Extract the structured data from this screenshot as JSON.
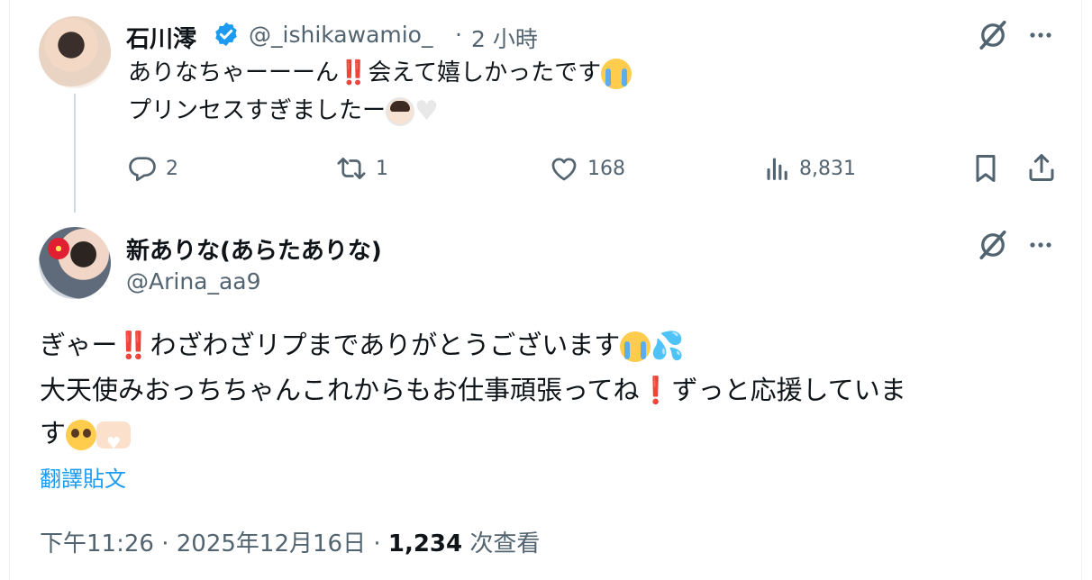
{
  "reply_tweet": {
    "author_name": "石川澪",
    "handle": "@_ishikawamio_",
    "separator": "·",
    "time": "2 小時",
    "line1_prefix": "ありなちゃーーーん",
    "line1_bang": "‼️",
    "line1_mid": "会えて嬉しかったです",
    "line2": "プリンセスすぎましたー",
    "stats": {
      "replies": "2",
      "reposts": "1",
      "likes": "168",
      "views": "8,831"
    }
  },
  "main_tweet": {
    "author_name": "新ありな(あらたありな)",
    "handle": "@Arina_aa9",
    "line1_prefix": "ぎゃー",
    "line1_bang": "‼️",
    "line1_rest": "わざわざリプまでありがとうございます",
    "line2_prefix": "大天使みおっちちゃんこれからもお仕事頑張ってね",
    "line2_bang": "❗",
    "line2_rest": "ずっと応援していま",
    "line3": "す",
    "translate_label": "翻譯貼文",
    "time": "下午11:26",
    "separator1": "·",
    "date": "2025年12月16日",
    "separator2": "·",
    "views_count": "1,234",
    "views_label": "次查看"
  },
  "icons": [
    "verified-badge-icon",
    "grok-icon",
    "more-icon",
    "reply-icon",
    "repost-icon",
    "like-icon",
    "views-icon",
    "bookmark-icon",
    "share-icon"
  ],
  "colors": {
    "text": "#0f1419",
    "secondary": "#536471",
    "link": "#1d9bf0",
    "verified": "#1d9bf0"
  }
}
